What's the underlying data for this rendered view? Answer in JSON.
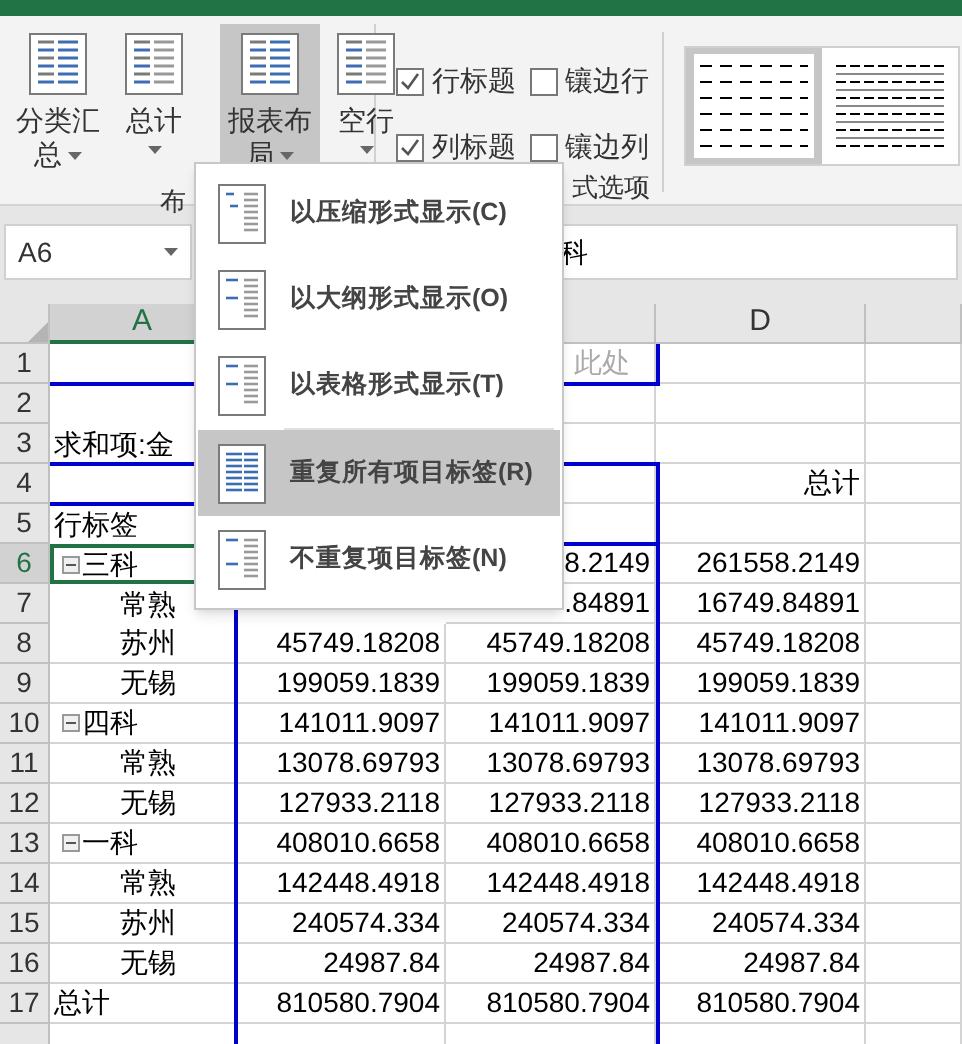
{
  "ribbon": {
    "buttons": [
      {
        "lines": [
          "分类汇",
          "总"
        ],
        "selected": false
      },
      {
        "lines": [
          "总计"
        ],
        "selected": false
      },
      {
        "lines": [
          "报表布",
          "局"
        ],
        "selected": true
      },
      {
        "lines": [
          "空行"
        ],
        "selected": false
      }
    ],
    "options": [
      {
        "label": "行标题",
        "checked": true
      },
      {
        "label": "镶边行",
        "checked": false
      },
      {
        "label": "列标题",
        "checked": true
      },
      {
        "label": "镶边列",
        "checked": false
      }
    ],
    "group_labels": [
      "布",
      "式选项"
    ],
    "styles": [
      {
        "selected": true
      },
      {
        "selected": false
      }
    ]
  },
  "name_box": "A6",
  "formula_text": "科",
  "layout_menu": [
    {
      "kind": "compact",
      "label": "以压缩形式显示(C)",
      "selected": false
    },
    {
      "kind": "outline",
      "label": "以大纲形式显示(O)",
      "selected": false
    },
    {
      "kind": "tabular",
      "label": "以表格形式显示(T)",
      "selected": false
    },
    {
      "kind": "repeat",
      "label": "重复所有项目标签(R)",
      "selected": true
    },
    {
      "kind": "norepeat",
      "label": "不重复项目标签(N)",
      "selected": false
    }
  ],
  "sheet": {
    "columns": [
      {
        "label": "A",
        "selected": true
      },
      {},
      {
        "selected": false
      },
      {
        "label": "D",
        "selected": false
      },
      {
        "selected": false
      }
    ],
    "rows": [
      {
        "num": "1",
        "selected": false,
        "cells": [
          null,
          null,
          "此处",
          null
        ]
      },
      {
        "num": "2",
        "selected": false,
        "cells": [
          null,
          null,
          null,
          null
        ]
      },
      {
        "num": "3",
        "selected": false,
        "cells": [
          "求和项:金",
          null,
          null,
          null
        ]
      },
      {
        "num": "4",
        "selected": false,
        "cells": [
          null,
          null,
          null,
          "总计"
        ]
      },
      {
        "num": "5",
        "selected": false,
        "cells": [
          "行标签",
          null,
          null,
          null
        ]
      },
      {
        "num": "6",
        "selected": true,
        "kind": "group",
        "expanded": true,
        "cells": [
          "三科",
          null,
          "8.2149",
          "261558.2149"
        ]
      },
      {
        "num": "7",
        "selected": false,
        "kind": "item",
        "cells": [
          "常熟",
          null,
          ".84891",
          "16749.84891"
        ]
      },
      {
        "num": "8",
        "selected": false,
        "kind": "item",
        "cells": [
          "苏州",
          "45749.18208",
          "45749.18208",
          "45749.18208"
        ]
      },
      {
        "num": "9",
        "selected": false,
        "kind": "item",
        "cells": [
          "无锡",
          "199059.1839",
          "199059.1839",
          "199059.1839"
        ]
      },
      {
        "num": "10",
        "selected": false,
        "kind": "group",
        "expanded": true,
        "cells": [
          "四科",
          "141011.9097",
          "141011.9097",
          "141011.9097"
        ]
      },
      {
        "num": "11",
        "selected": false,
        "kind": "item",
        "cells": [
          "常熟",
          "13078.69793",
          "13078.69793",
          "13078.69793"
        ]
      },
      {
        "num": "12",
        "selected": false,
        "kind": "item",
        "cells": [
          "无锡",
          "127933.2118",
          "127933.2118",
          "127933.2118"
        ]
      },
      {
        "num": "13",
        "selected": false,
        "kind": "group",
        "expanded": true,
        "cells": [
          "一科",
          "408010.6658",
          "408010.6658",
          "408010.6658"
        ]
      },
      {
        "num": "14",
        "selected": false,
        "kind": "item",
        "cells": [
          "常熟",
          "142448.4918",
          "142448.4918",
          "142448.4918"
        ]
      },
      {
        "num": "15",
        "selected": false,
        "kind": "item",
        "cells": [
          "苏州",
          "240574.334",
          "240574.334",
          "240574.334"
        ]
      },
      {
        "num": "16",
        "selected": false,
        "kind": "item",
        "cells": [
          "无锡",
          "24987.84",
          "24987.84",
          "24987.84"
        ]
      },
      {
        "num": "17",
        "selected": false,
        "cells": [
          "总计",
          "810580.7904",
          "810580.7904",
          "810580.7904"
        ]
      },
      {
        "selected": false,
        "cells": [
          null,
          null,
          null,
          null
        ]
      }
    ]
  }
}
